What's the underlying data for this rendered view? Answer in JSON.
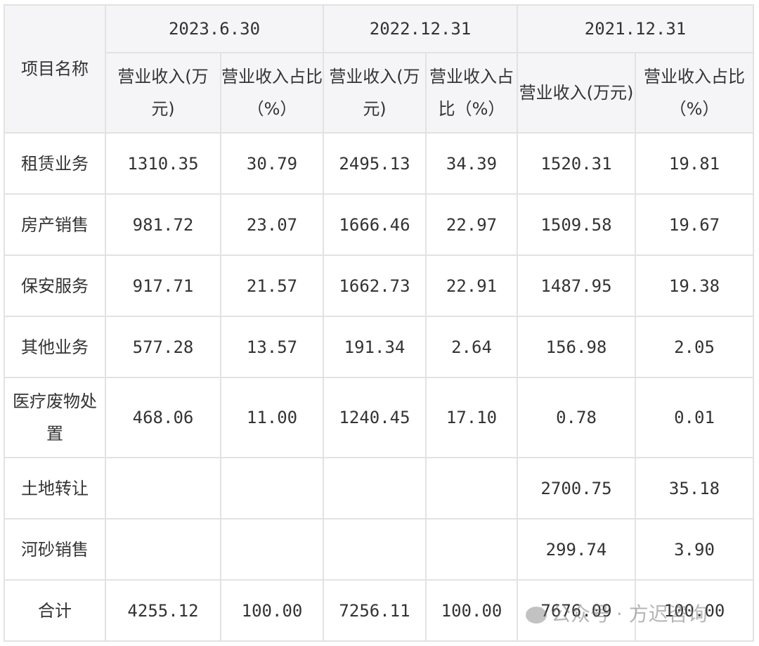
{
  "header": {
    "item_name": "项目名称",
    "periods": [
      "2023.6.30",
      "2022.12.31",
      "2021.12.31"
    ],
    "sub": [
      [
        "营业收入(万元)",
        "营业收入占比（%）"
      ],
      [
        "营业收入(万元)",
        "营业收入占比（%）"
      ],
      [
        "营业收入(万元)",
        "营业收入占比（%）"
      ]
    ]
  },
  "rows": [
    {
      "name": "租赁业务",
      "v": [
        "1310.35",
        "30.79",
        "2495.13",
        "34.39",
        "1520.31",
        "19.81"
      ]
    },
    {
      "name": "房产销售",
      "v": [
        "981.72",
        "23.07",
        "1666.46",
        "22.97",
        "1509.58",
        "19.67"
      ]
    },
    {
      "name": "保安服务",
      "v": [
        "917.71",
        "21.57",
        "1662.73",
        "22.91",
        "1487.95",
        "19.38"
      ]
    },
    {
      "name": "其他业务",
      "v": [
        "577.28",
        "13.57",
        "191.34",
        "2.64",
        "156.98",
        "2.05"
      ]
    },
    {
      "name": "医疗废物处置",
      "v": [
        "468.06",
        "11.00",
        "1240.45",
        "17.10",
        "0.78",
        "0.01"
      ]
    },
    {
      "name": "土地转让",
      "v": [
        "",
        "",
        "",
        "",
        "2700.75",
        "35.18"
      ]
    },
    {
      "name": "河砂销售",
      "v": [
        "",
        "",
        "",
        "",
        "299.74",
        "3.90"
      ]
    },
    {
      "name": "合计",
      "v": [
        "4255.12",
        "100.00",
        "7256.11",
        "100.00",
        "7676.09",
        "100.00"
      ]
    }
  ],
  "watermark": "公众号 · 方迟咨询"
}
